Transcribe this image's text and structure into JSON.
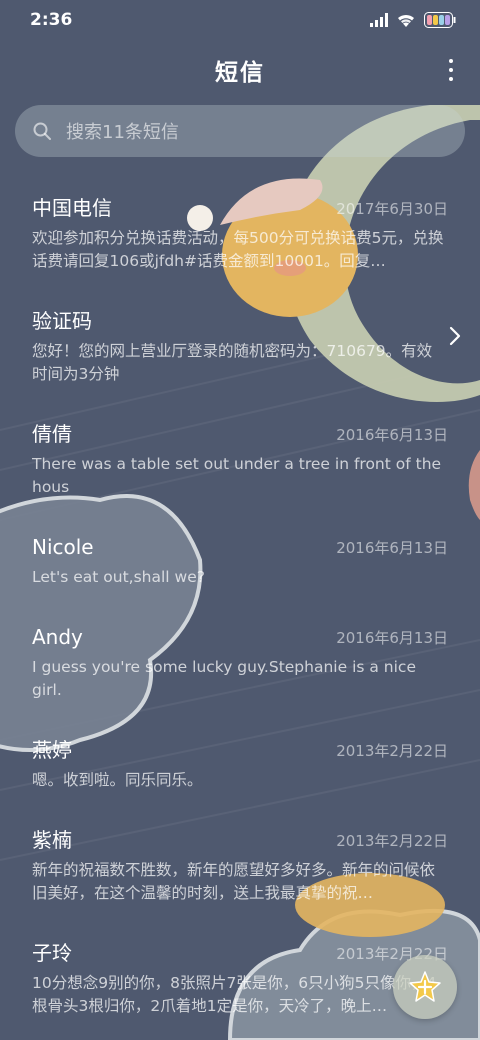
{
  "status_bar": {
    "time": "2:36"
  },
  "header": {
    "title": "短信"
  },
  "search": {
    "placeholder": "搜索11条短信"
  },
  "conversations": [
    {
      "name": "中国电信",
      "date": "2017年6月30日",
      "preview": "欢迎参加积分兑换话费活动，每500分可兑换话费5元，兑换话费请回复106或jfdh#话费金额到10001。回复…"
    },
    {
      "name": "验证码",
      "date": "",
      "preview": "您好！您的网上营业厅登录的随机密码为：710679。有效时间为3分钟"
    },
    {
      "name": "倩倩",
      "date": "2016年6月13日",
      "preview": "There was a table set out under a tree in front of the hous"
    },
    {
      "name": "Nicole",
      "date": "2016年6月13日",
      "preview": "Let's eat out,shall we?"
    },
    {
      "name": "Andy",
      "date": "2016年6月13日",
      "preview": "I guess you're some lucky guy.Stephanie is a nice girl."
    },
    {
      "name": "燕婷",
      "date": "2013年2月22日",
      "preview": "嗯。收到啦。同乐同乐。"
    },
    {
      "name": "紫楠",
      "date": "2013年2月22日",
      "preview": "新年的祝福数不胜数，新年的愿望好多好多。新年的问候依旧美好，在这个温馨的时刻，送上我最真挚的祝…"
    },
    {
      "name": "子玲",
      "date": "2013年2月22日",
      "preview": "10分想念9别的你，8张照片7张是你，6只小狗5只像你，4根骨头3根归你，2爪着地1定是你，天冷了，晚上…"
    }
  ],
  "colors": {
    "background": "#4f596f",
    "text": "#ffffff",
    "accent": "#f3c94a"
  }
}
